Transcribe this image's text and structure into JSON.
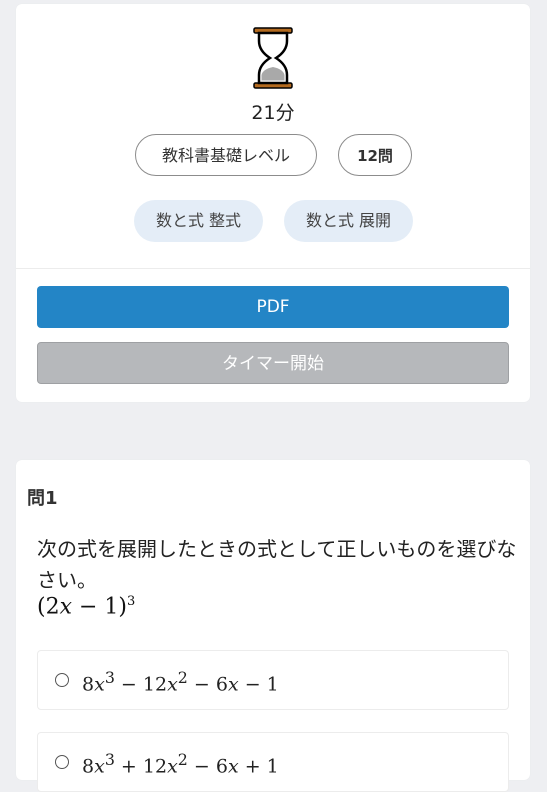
{
  "quiz": {
    "duration": "21分",
    "level": "教科書基礎レベル",
    "question_count": "12問",
    "tags": [
      "数と式 整式",
      "数と式 展開"
    ],
    "pdf_label": "PDF",
    "timer_label": "タイマー開始"
  },
  "question": {
    "title": "問1",
    "text": "次の式を展開したときの式として正しいものを選びなさい。",
    "expression": {
      "base": "(2𝑥 − 1)",
      "exponent": "3"
    },
    "options": [
      {
        "t1": "8𝑥",
        "e1": "3",
        "t2": " − 12𝑥",
        "e2": "2",
        "t3": " − 6𝑥 − 1"
      },
      {
        "t1": "8𝑥",
        "e1": "3",
        "t2": " + 12𝑥",
        "e2": "2",
        "t3": " − 6𝑥 + 1"
      }
    ]
  },
  "icons": {
    "timer": "hourglass-icon",
    "option": "radio-circle-icon"
  },
  "colors": {
    "primary": "#2385c6",
    "disabled": "#b6b8bb",
    "tag_bg": "#e4edf7",
    "page_bg": "#eeeff2"
  }
}
